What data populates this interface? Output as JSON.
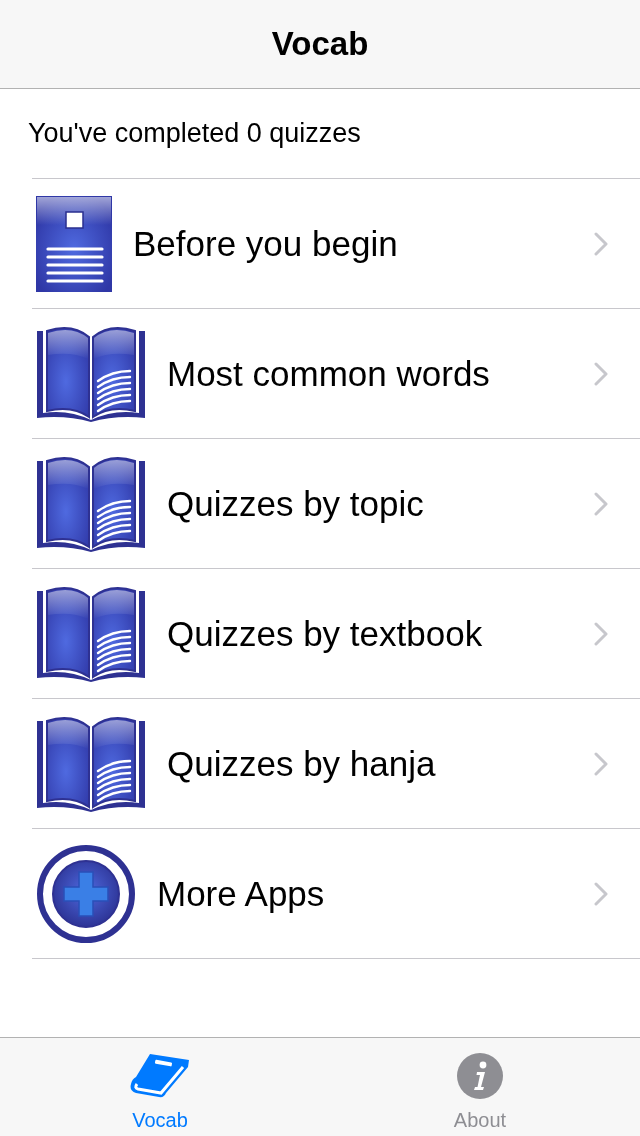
{
  "nav_bar": {
    "title": "Vocab"
  },
  "progress_text": "You've completed 0 quizzes",
  "menu": [
    {
      "kind": "document",
      "label": "Before you begin"
    },
    {
      "kind": "book",
      "label": "Most common words"
    },
    {
      "kind": "book",
      "label": "Quizzes by topic"
    },
    {
      "kind": "book",
      "label": "Quizzes by textbook"
    },
    {
      "kind": "book",
      "label": "Quizzes by hanja"
    },
    {
      "kind": "plus",
      "label": "More Apps"
    }
  ],
  "tab_bar": [
    {
      "kind": "book",
      "label": "Vocab",
      "selected": true
    },
    {
      "kind": "info",
      "label": "About",
      "selected": false
    }
  ]
}
